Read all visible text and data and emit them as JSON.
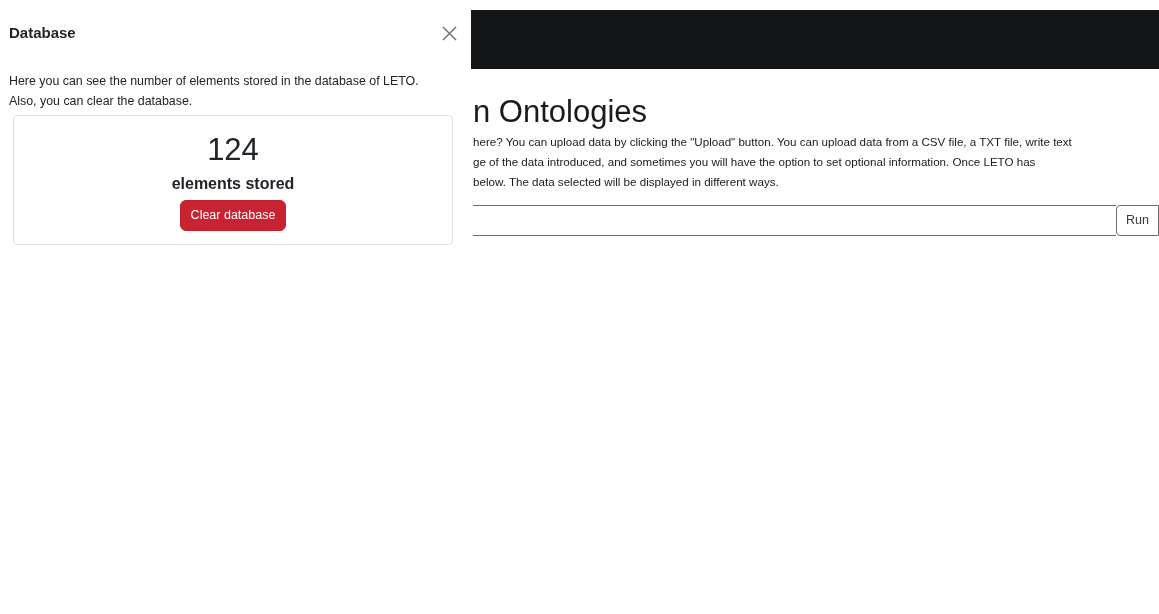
{
  "offcanvas": {
    "title": "Database",
    "description": "Here you can see the number of elements stored in the database of LETO. Also, you can clear the database.",
    "count": "124",
    "count_label": "elements stored",
    "clear_button": "Clear database"
  },
  "background_page": {
    "heading": "n Ontologies",
    "paragraph_lines": [
      "here? You can upload data by clicking the \"Upload\" button. You can upload data from a CSV file, a TXT file, write text",
      "ge of the data introduced, and sometimes you will have the option to set optional information. Once LETO has",
      "below. The data selected will be displayed in different ways."
    ],
    "run_button": "Run"
  }
}
